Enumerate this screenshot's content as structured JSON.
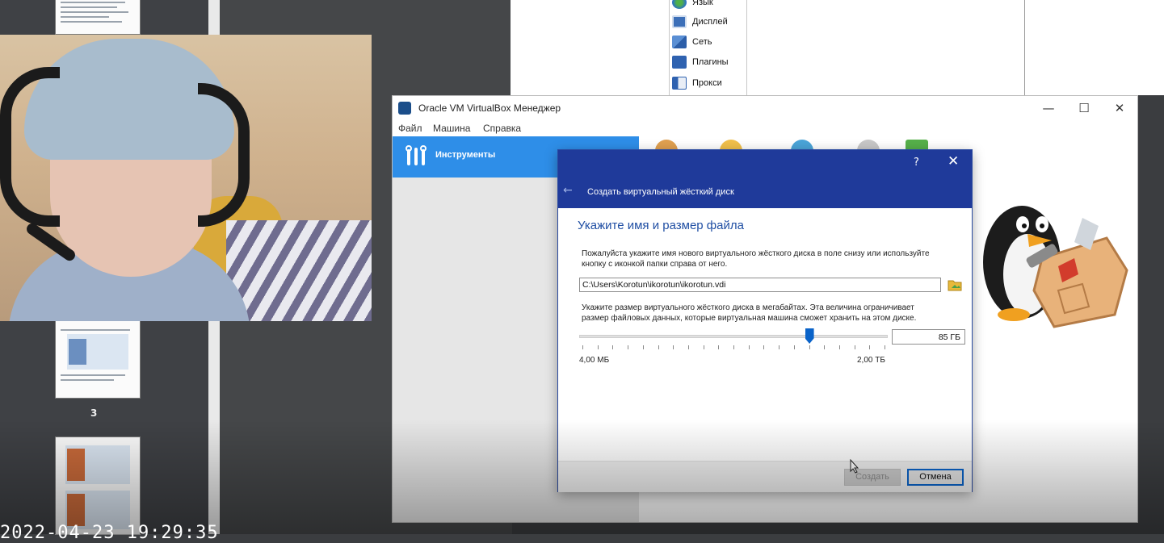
{
  "word_nav": {
    "page_number": "3"
  },
  "timestamp": "2022-04-23 19:29:35",
  "settings_window": {
    "items": [
      {
        "label": "Язык",
        "icon": "globe-icon"
      },
      {
        "label": "Дисплей",
        "icon": "display-icon"
      },
      {
        "label": "Сеть",
        "icon": "network-icon"
      },
      {
        "label": "Плагины",
        "icon": "plugins-icon"
      },
      {
        "label": "Прокси",
        "icon": "proxy-icon"
      }
    ]
  },
  "vbox": {
    "title": "Oracle VM VirtualBox Менеджер",
    "menu": [
      "Файл",
      "Машина",
      "Справка"
    ],
    "tools_label": "Инструменты",
    "window_buttons": {
      "minimize": "—",
      "maximize": "☐",
      "close": "✕"
    }
  },
  "dialog": {
    "help": "?",
    "close": "✕",
    "back": "←",
    "title": "Создать виртуальный жёсткий диск",
    "page_title": "Укажите имя и размер файла",
    "intro_line1": "Пожалуйста укажите имя нового виртуального жёсткого диска в поле снизу или используйте",
    "intro_line2": "кнопку с иконкой папки справа от него.",
    "file_path": "C:\\Users\\Korotun\\ikorotun\\ikorotun.vdi",
    "size_text_line1": "Укажите размер виртуального жёсткого диска в мегабайтах. Эта величина ограничивает",
    "size_text_line2": "размер файловых данных, которые виртуальная машина сможет хранить на этом диске.",
    "size_value": "85 ГБ",
    "slider_position": 0.745,
    "min_label": "4,00 МБ",
    "max_label": "2,00 ТБ",
    "create_button": "Создать",
    "cancel_button": "Отмена"
  },
  "colors": {
    "dialog_header": "#1f3a9a",
    "accent_blue": "#2e8ee8",
    "slider_blue": "#0a63c9",
    "page_title": "#1f4ea3"
  }
}
